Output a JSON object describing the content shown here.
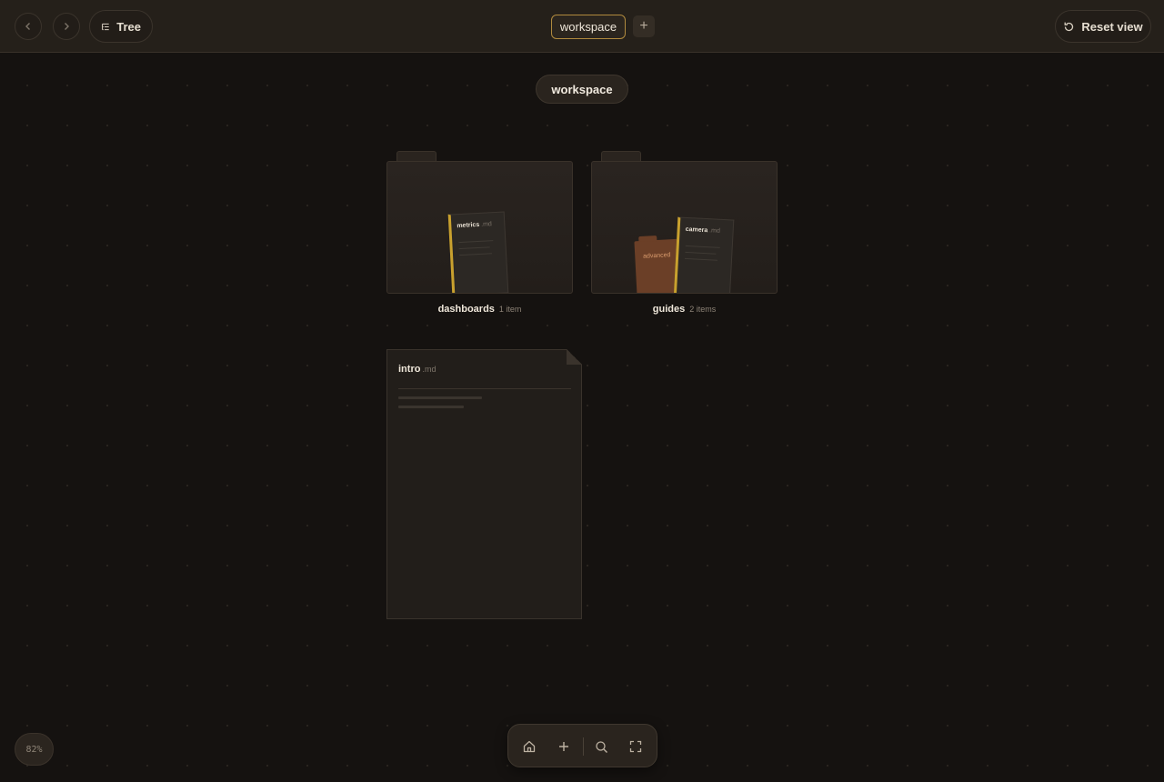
{
  "topbar": {
    "back_icon": "chevron-left-icon",
    "forward_icon": "chevron-right-icon",
    "tree_label": "Tree",
    "tree_icon": "tree-list-icon",
    "active_tab": "workspace",
    "add_tab_label": "+",
    "reset_label": "Reset view",
    "reset_icon": "rotate-ccw-icon"
  },
  "canvas": {
    "root_label": "workspace",
    "folders": [
      {
        "name": "dashboards",
        "count": "1 item",
        "preview_doc": {
          "name": "metrics",
          "ext": ".md"
        }
      },
      {
        "name": "guides",
        "count": "2 items",
        "preview_subfolder": "advanced",
        "preview_doc": {
          "name": "camera",
          "ext": ".md"
        }
      }
    ],
    "document": {
      "name": "intro",
      "ext": ".md"
    }
  },
  "bottom_toolbar": {
    "icons": [
      "home-icon",
      "plus-icon",
      "search-icon",
      "fullscreen-icon"
    ]
  },
  "zoom": "82%",
  "colors": {
    "background": "#151210",
    "accent": "#c9a12e",
    "subfolder": "#6b3f27"
  }
}
